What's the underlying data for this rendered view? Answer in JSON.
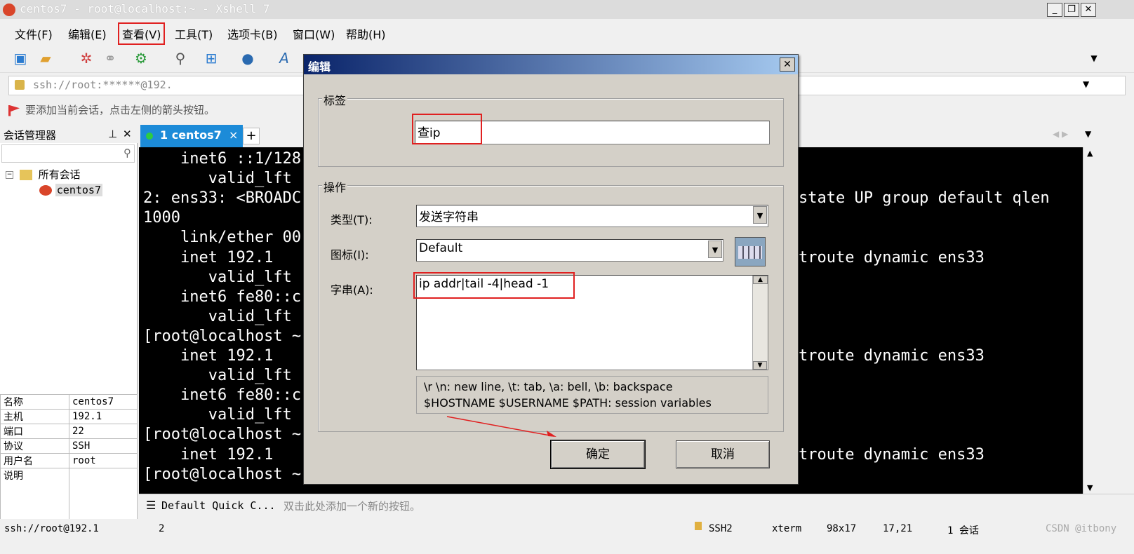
{
  "window": {
    "title": "centos7 - root@localhost:~ - Xshell 7"
  },
  "menu": [
    "文件(F)",
    "编辑(E)",
    "查看(V)",
    "工具(T)",
    "选项卡(B)",
    "窗口(W)",
    "帮助(H)"
  ],
  "address": "ssh://root:******@192.",
  "hint": "要添加当前会话，点击左侧的箭头按钮。",
  "session_manager": {
    "title": "会话管理器",
    "root": "所有会话",
    "child": "centos7",
    "props": [
      {
        "k": "名称",
        "v": "centos7"
      },
      {
        "k": "主机",
        "v": "192.1"
      },
      {
        "k": "端口",
        "v": "22"
      },
      {
        "k": "协议",
        "v": "SSH"
      },
      {
        "k": "用户名",
        "v": "root"
      },
      {
        "k": "说明",
        "v": ""
      }
    ]
  },
  "tab": {
    "label": "1 centos7",
    "close": "×",
    "add": "+"
  },
  "terminal": {
    "left_lines": [
      "    inet6 ::1/128",
      "       valid_lft",
      "2: ens33: <BROADC",
      "1000",
      "    link/ether 00",
      "    inet 192.1",
      "       valid_lft",
      "    inet6 fe80::c",
      "       valid_lft",
      "[root@localhost ~",
      "    inet 192.1",
      "       valid_lft",
      "    inet6 fe80::c",
      "       valid_lft",
      "[root@localhost ~",
      "    inet 192.1",
      "[root@localhost ~"
    ],
    "right_lines": [
      {
        "row": 2,
        "text": "state UP group default qlen"
      },
      {
        "row": 5,
        "text": "troute dynamic ens33"
      },
      {
        "row": 10,
        "text": "troute dynamic ens33"
      },
      {
        "row": 15,
        "text": "troute dynamic ens33"
      }
    ]
  },
  "quickbar": {
    "name": "Default Quick C...",
    "hint": "双击此处添加一个新的按钮。"
  },
  "status": {
    "left": "ssh://root@192.1",
    "left_tail": "2",
    "protocol": "SSH2",
    "term": "xterm",
    "size": "98x17",
    "pos": "17,21",
    "sessions": "1 会话",
    "brand": "CSDN @itbony"
  },
  "dialog": {
    "title": "编辑",
    "close": "✕",
    "label_group": "标签",
    "label_value": "查ip",
    "action_group": "操作",
    "type_label": "类型(T):",
    "type_value": "发送字符串",
    "icon_label": "图标(I):",
    "icon_value": "Default",
    "string_label": "字串(A):",
    "string_value": "ip addr|tail -4|head -1",
    "help_line1": "\\r \\n: new line, \\t: tab, \\a: bell, \\b: backspace",
    "help_line2": "$HOSTNAME $USERNAME $PATH: session variables",
    "ok": "确定",
    "cancel": "取消"
  }
}
